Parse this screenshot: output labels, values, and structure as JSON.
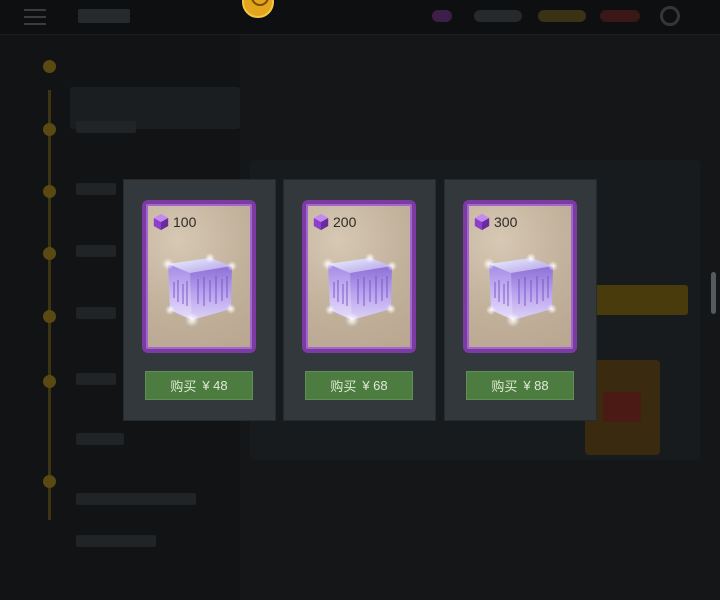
{
  "colors": {
    "panel": "#32383b",
    "card_border": "#7b3ba3",
    "buy_button": "#4c7c40",
    "gem": "#9b55d6"
  },
  "icons": {
    "gem": "purple-gem-cube-icon",
    "product": "glowing-crystal-cube-icon"
  },
  "offers": [
    {
      "quantity": "100",
      "buy_label": "购买",
      "price": "¥ 48"
    },
    {
      "quantity": "200",
      "buy_label": "购买",
      "price": "¥ 68"
    },
    {
      "quantity": "300",
      "buy_label": "购买",
      "price": "¥ 88"
    }
  ]
}
